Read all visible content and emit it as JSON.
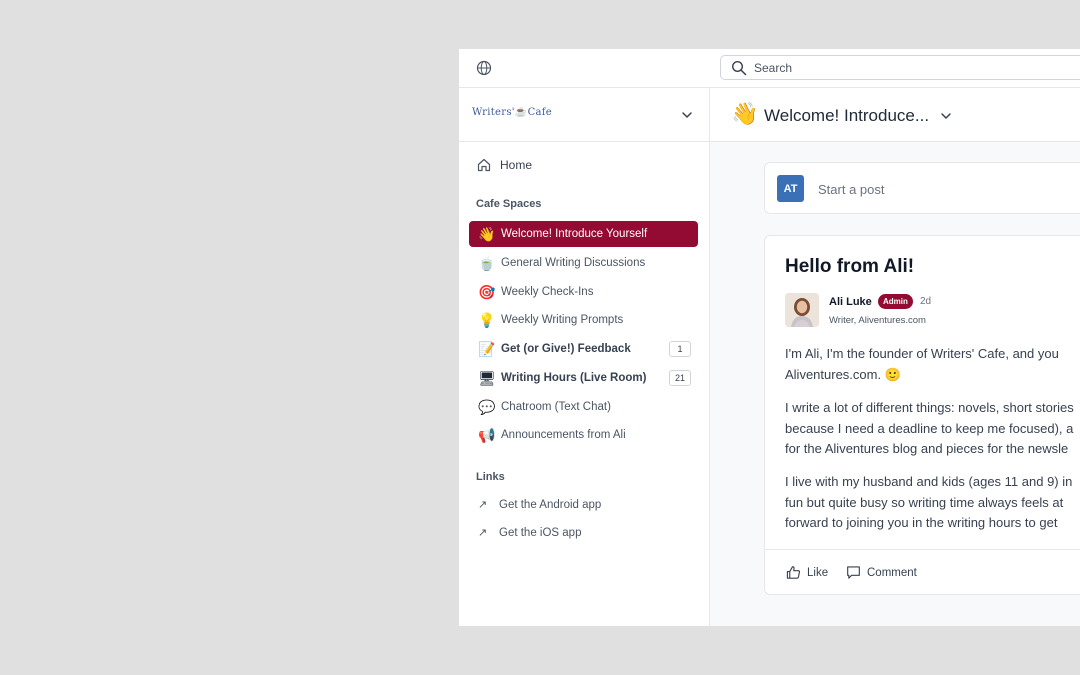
{
  "topbar": {
    "search_placeholder": "Search",
    "globe_icon": "globe-icon",
    "search_icon": "search-icon"
  },
  "brand": {
    "logo_text_left": "Writers'",
    "logo_cup": "☕",
    "logo_text_right": "Cafe"
  },
  "sidebar": {
    "home_label": "Home",
    "spaces_title": "Cafe Spaces",
    "spaces": [
      {
        "emoji": "👋",
        "label": "Welcome! Introduce Yourself",
        "badge": ""
      },
      {
        "emoji": "🍵",
        "label": "General Writing Discussions",
        "badge": ""
      },
      {
        "emoji": "🎯",
        "label": "Weekly Check-Ins",
        "badge": ""
      },
      {
        "emoji": "💡",
        "label": "Weekly Writing Prompts",
        "badge": ""
      },
      {
        "emoji": "📝",
        "label": "Get (or Give!) Feedback",
        "badge": "1"
      },
      {
        "emoji": "🖥",
        "label": "Writing Hours (Live Room)",
        "badge": "21"
      },
      {
        "emoji": "💬",
        "label": "Chatroom (Text Chat)",
        "badge": ""
      },
      {
        "emoji": "📢",
        "label": "Announcements from Ali",
        "badge": ""
      }
    ],
    "links_title": "Links",
    "links": [
      {
        "label": "Get the Android app"
      },
      {
        "label": "Get the iOS app"
      }
    ]
  },
  "main": {
    "header_emoji": "👋",
    "header_title": "Welcome! Introduce...",
    "composer_avatar": "AT",
    "composer_placeholder": "Start a post",
    "post": {
      "title": "Hello from Ali!",
      "author": "Ali Luke",
      "badge": "Admin",
      "age": "2d",
      "role": "Writer, Aliventures.com",
      "p1": [
        "I'm Ali, I'm the founder of Writers' Cafe, and you",
        "Aliventures.com. 🙂"
      ],
      "p2": [
        "I write a lot of different things: novels, short stories",
        "because I need a deadline to keep me focused), a",
        "for the Aliventures blog and pieces for the newsle"
      ],
      "p3": [
        "I live with my husband and kids (ages 11 and 9) in",
        "fun but quite busy so writing time always feels at",
        "forward to joining you in the writing hours to get"
      ],
      "like_label": "Like",
      "comment_label": "Comment"
    }
  },
  "colors": {
    "accent": "#930b33",
    "avatar_blue": "#3b6fb6"
  }
}
